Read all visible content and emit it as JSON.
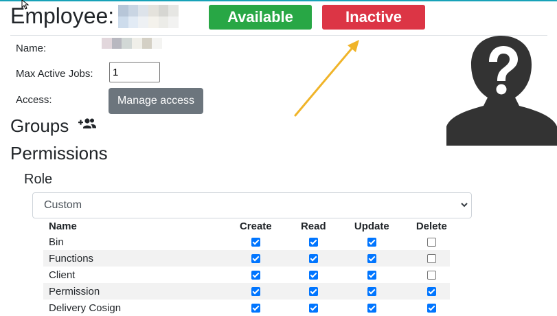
{
  "employee": {
    "title": "Employee:",
    "status_buttons": {
      "available": "Available",
      "inactive": "Inactive"
    }
  },
  "fields": {
    "name_label": "Name:",
    "max_jobs_label": "Max Active Jobs:",
    "max_jobs_value": "1",
    "access_label": "Access:",
    "manage_access_button": "Manage access"
  },
  "sections": {
    "groups": "Groups",
    "permissions": "Permissions",
    "role": "Role"
  },
  "role_select": {
    "selected": "Custom"
  },
  "permissions_table": {
    "headers": [
      "Name",
      "Create",
      "Read",
      "Update",
      "Delete"
    ],
    "rows": [
      {
        "name": "Bin",
        "create": true,
        "read": true,
        "update": true,
        "delete": false
      },
      {
        "name": "Functions",
        "create": true,
        "read": true,
        "update": true,
        "delete": false
      },
      {
        "name": "Client",
        "create": true,
        "read": true,
        "update": true,
        "delete": false
      },
      {
        "name": "Permission",
        "create": true,
        "read": true,
        "update": true,
        "delete": true
      },
      {
        "name": "Delivery Cosign",
        "create": true,
        "read": true,
        "update": true,
        "delete": true
      }
    ]
  },
  "icons": {
    "groups": "add-users-icon",
    "avatar": "unknown-person-icon",
    "annotation": "arrow-annotation",
    "cursor": "mouse-cursor-icon"
  },
  "colors": {
    "available": "#28a745",
    "inactive": "#dc3545",
    "manage": "#6c757d",
    "checkbox": "#0075ff",
    "annotation_arrow": "#f0b429"
  }
}
